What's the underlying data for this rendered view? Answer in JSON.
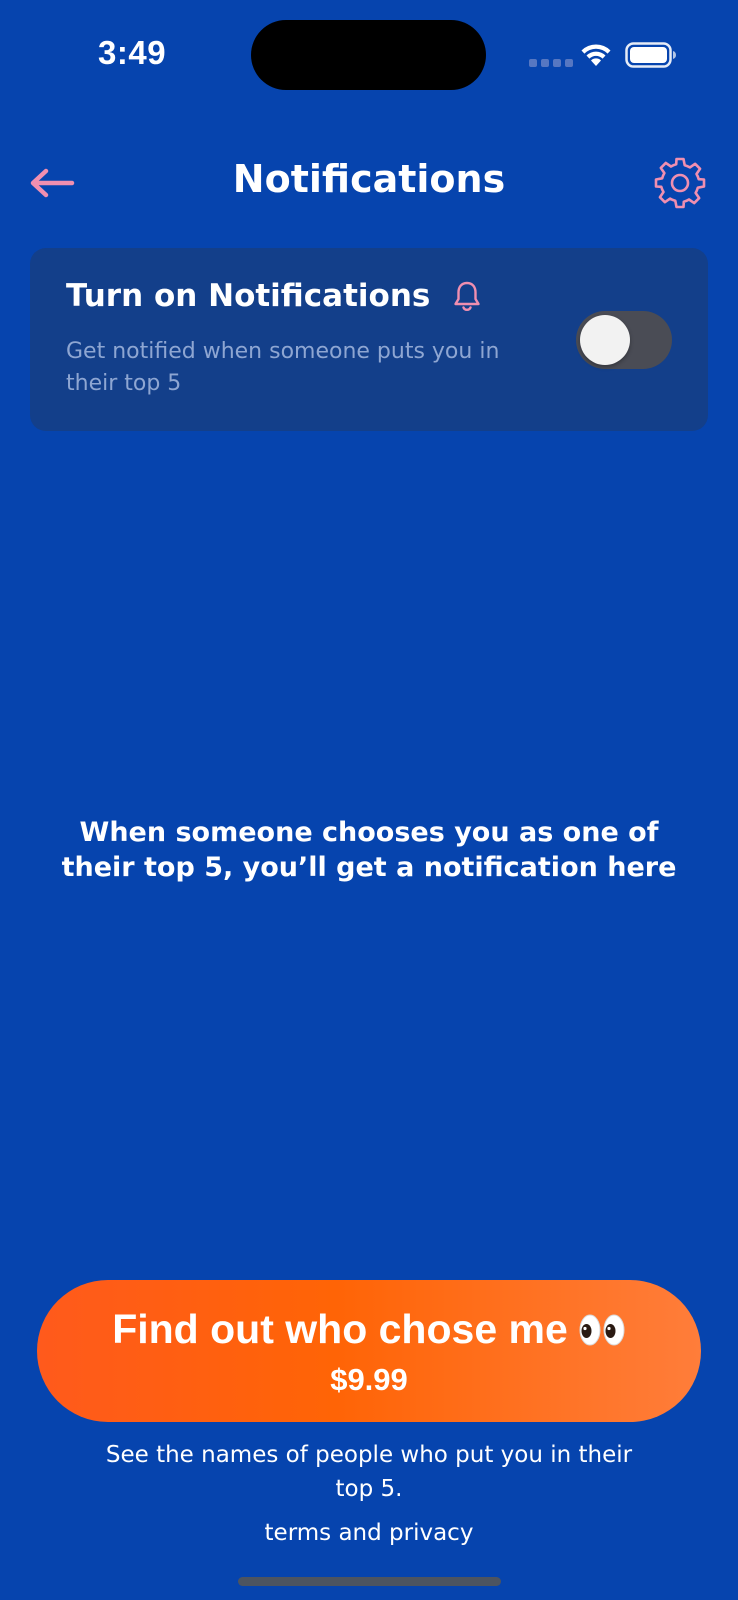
{
  "status_bar": {
    "time": "3:49",
    "icons": [
      "signal-icon",
      "wifi-icon",
      "battery-icon"
    ]
  },
  "header": {
    "title": "Notifications",
    "back_icon": "arrow-left-icon",
    "settings_icon": "gear-icon"
  },
  "notification_card": {
    "title": "Turn on Notifications",
    "icon": "bell-icon",
    "description": "Get notified when someone puts you in their top 5",
    "toggle_on": false
  },
  "empty_state": {
    "message": "When someone chooses you as one of their top 5, you’ll get a notification here"
  },
  "cta": {
    "label": "Find out who chose me",
    "emoji_icon": "eyes-icon",
    "price": "$9.99",
    "subtext": "See the names of people who put you in their top 5.",
    "terms_label": "terms and privacy"
  },
  "colors": {
    "background": "#0644ae",
    "card": "#133f8a",
    "accent_pink": "#f08fb0",
    "cta_orange": "#ff6406"
  }
}
